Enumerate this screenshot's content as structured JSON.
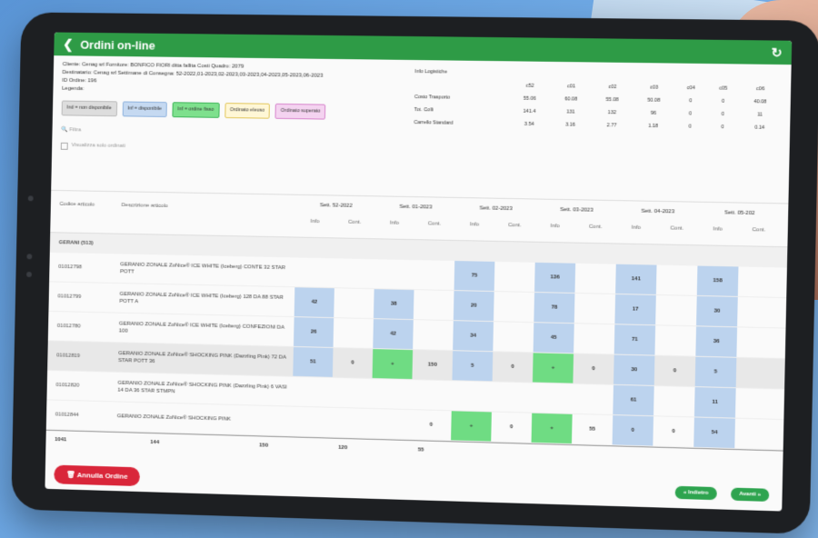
{
  "app": {
    "title": "Ordini on-line"
  },
  "info": {
    "line1": "Cliente: Cenag srl   Fornitore: BONFICO FIORI ditta fallita   Costi Quadro: 2079",
    "line2": "Destinatario: Cenag srl   Settimane di Consegna: 52-2022,01-2023,02-2023,03-2023,04-2023,05-2023,06-2023",
    "line3": "ID Ordine: 196",
    "legend_label": "Legenda:",
    "legend": [
      "Ind = non disponibile",
      "Inf = disponibile",
      "Inf = ordine fisso",
      "Ordinato eleuso",
      "Ordinato superato"
    ],
    "filter_placeholder": "Filtra",
    "checkbox_label": "Visualizza solo ordinati"
  },
  "summary": {
    "headers": [
      "",
      "c52",
      "c01",
      "c02",
      "c03",
      "c04",
      "c05",
      "c06"
    ],
    "rows": [
      [
        "Info Logistiche",
        "",
        "",
        "",
        "",
        "",
        "",
        ""
      ],
      [
        "Costo Trasporto",
        "55.06",
        "60.08",
        "55.08",
        "50.08",
        "0",
        "0",
        "40.08"
      ],
      [
        "Tot. Colli",
        "141.4",
        "131",
        "132",
        "96",
        "0",
        "0",
        "11"
      ],
      [
        "Carrello Standard",
        "3.54",
        "3.16",
        "2.77",
        "1.18",
        "0",
        "0",
        "0.14"
      ]
    ]
  },
  "grid": {
    "col_code": "Codice articolo",
    "col_desc": "Descrizione articolo",
    "weeks": [
      "Sett. 52-2022",
      "Sett. 01-2023",
      "Sett. 02-2023",
      "Sett. 03-2023",
      "Sett. 04-2023",
      "Sett. 05-202"
    ],
    "sub_info": "Info",
    "sub_cont": "Cont.",
    "group": "GERANI (513)",
    "rows": [
      {
        "code": "01012798",
        "desc": "GERANIO ZONALE ZoNice® ICE WHITE (Iceberg) CONTE 32 STAR POTT",
        "cells": [
          "",
          "",
          "",
          "",
          "75",
          "",
          "136",
          "",
          "141",
          "",
          "158",
          ""
        ]
      },
      {
        "code": "01012799",
        "desc": "GERANIO ZONALE ZoNice® ICE WHITE (Iceberg) 128 DA 88 STAR POTT A",
        "cells": [
          "42",
          "",
          "38",
          "",
          "20",
          "",
          "78",
          "",
          "17",
          "",
          "30",
          ""
        ]
      },
      {
        "code": "01012780",
        "desc": "GERANIO ZONALE ZoNice® ICE WHITE (Iceberg) CONFEZIONI DA 100",
        "cells": [
          "26",
          "",
          "42",
          "",
          "34",
          "",
          "45",
          "",
          "71",
          "",
          "36",
          ""
        ]
      },
      {
        "code": "01012819",
        "desc": "GERANIO ZONALE ZoNice® SHOCKING PINK (Dazzling Pink) 72 DA STAR POTT 36",
        "cells": [
          "51",
          "0",
          "+",
          "150",
          "5",
          "0",
          "+",
          "0",
          "30",
          "0",
          "5",
          ""
        ]
      },
      {
        "code": "01012820",
        "desc": "GERANIO ZONALE ZoNice® SHOCKING PINK (Dazzling Pink) 6 VASI 14 DA 36 STAR STMPN",
        "cells": [
          "",
          "",
          "",
          "",
          "",
          "",
          "",
          "",
          "61",
          "",
          "11",
          ""
        ]
      },
      {
        "code": "01012844",
        "desc": "GERANIO ZONALE ZoNice® SHOCKING PINK",
        "cells": [
          "",
          "",
          "",
          "0",
          "+",
          "0",
          "+",
          "55",
          "0",
          "0",
          "54",
          ""
        ]
      }
    ],
    "totals": [
      "1041",
      "144",
      "150",
      "120",
      "55"
    ]
  },
  "footer": {
    "cancel": "Annulla Ordine",
    "back": "« Indietro",
    "next": "Avanti »"
  },
  "colors": {
    "green": "#2e9b46",
    "blue_cell": "#bcd3ee",
    "green_cell": "#6fdc83",
    "red": "#d9263a"
  }
}
